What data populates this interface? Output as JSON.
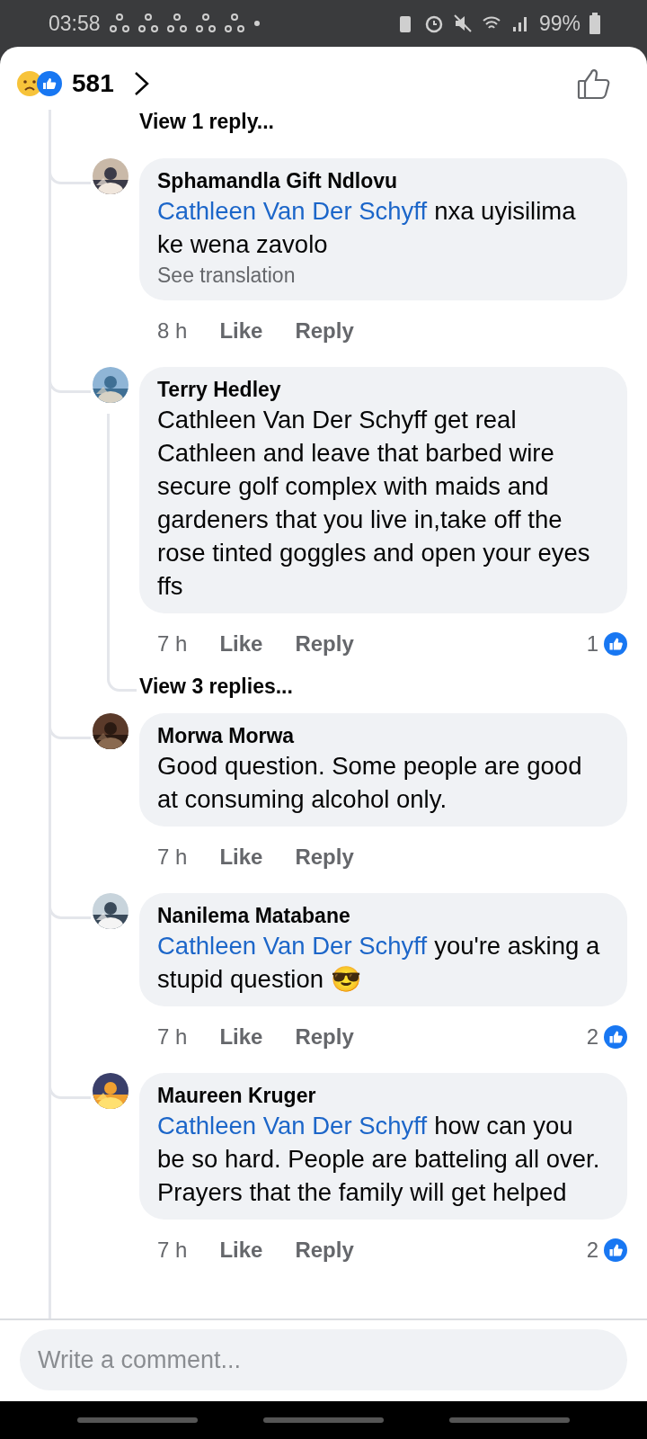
{
  "status_bar": {
    "time": "03:58",
    "battery": "99%"
  },
  "header": {
    "reaction_count": "581"
  },
  "top_thread_link": "View 1 reply...",
  "comments": [
    {
      "author": "Sphamandla Gift Ndlovu",
      "mention": "Cathleen Van Der Schyff",
      "text": "nxa uyisilima ke wena zavolo",
      "translation": "See translation",
      "time": "8 h",
      "like": "Like",
      "reply": "Reply"
    },
    {
      "author": "Terry Hedley",
      "text": "Cathleen Van Der Schyff get real Cathleen and leave that barbed wire secure golf complex with maids and gardeners that you live in,take off the rose tinted goggles and open your eyes ffs",
      "time": "7 h",
      "like": "Like",
      "reply": "Reply",
      "like_count": "1",
      "replies_link": "View 3 replies..."
    },
    {
      "author": "Morwa Morwa",
      "text": "Good question. Some people are good at consuming alcohol only.",
      "time": "7 h",
      "like": "Like",
      "reply": "Reply"
    },
    {
      "author": "Nanilema Matabane",
      "mention": "Cathleen Van Der Schyff",
      "text": "you're asking a stupid question 😎",
      "time": "7 h",
      "like": "Like",
      "reply": "Reply",
      "like_count": "2"
    },
    {
      "author": "Maureen Kruger",
      "mention": "Cathleen Van Der Schyff",
      "text": "how can you be so hard. People are batteling all over. Prayers that the family will get helped",
      "time": "7 h",
      "like": "Like",
      "reply": "Reply",
      "like_count": "2"
    }
  ],
  "composer": {
    "placeholder": "Write a comment..."
  }
}
